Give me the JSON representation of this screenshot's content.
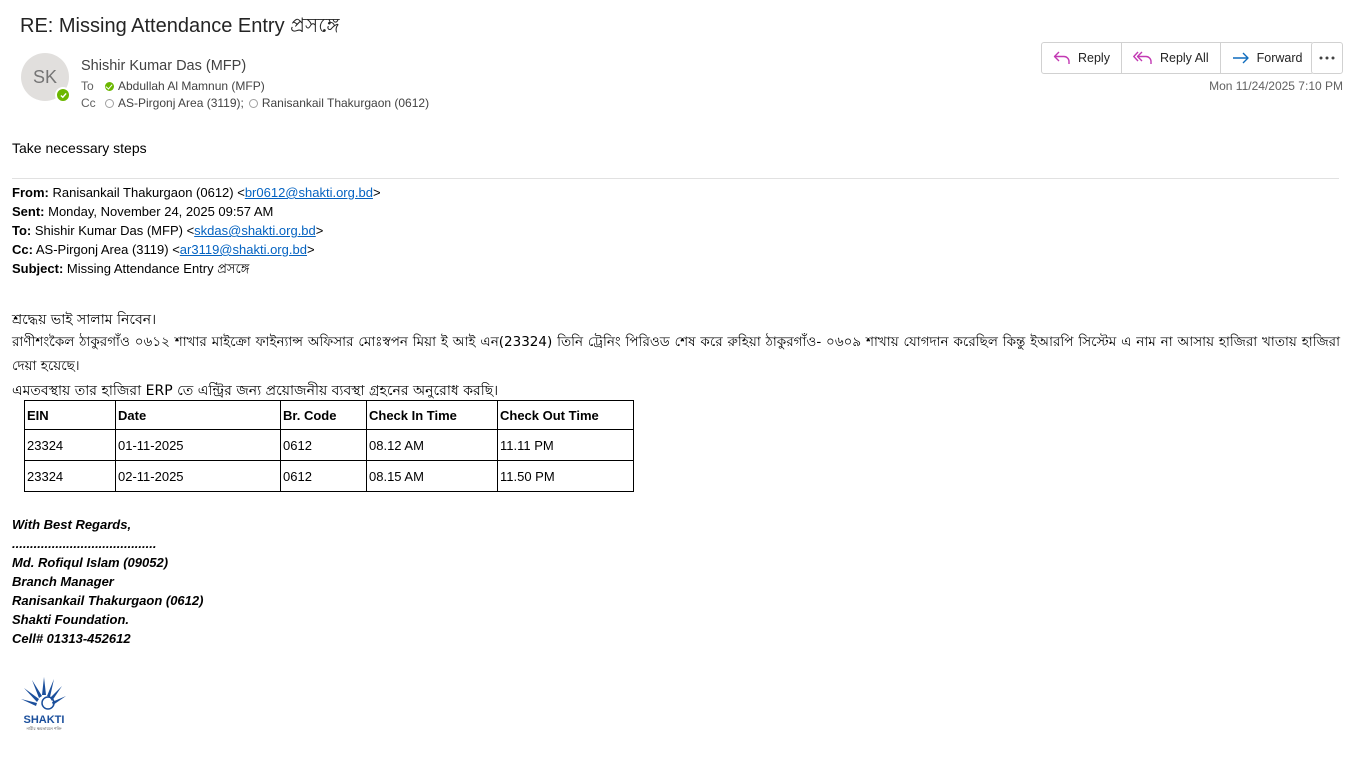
{
  "subject": "RE: Missing Attendance Entry প্রসঙ্গে",
  "sender": {
    "initials": "SK",
    "name": "Shishir Kumar Das (MFP)"
  },
  "to": {
    "label": "To",
    "recipients": [
      "Abdullah Al Mamnun (MFP)"
    ]
  },
  "cc": {
    "label": "Cc",
    "recipients": [
      "AS-Pirgonj Area (3119);",
      "Ranisankail Thakurgaon (0612)"
    ]
  },
  "actions": {
    "reply": "Reply",
    "reply_all": "Reply All",
    "forward": "Forward"
  },
  "timestamp": "Mon 11/24/2025 7:10 PM",
  "reply_body": "Take necessary steps",
  "original": {
    "from_label": "From:",
    "from_text": "Ranisankail Thakurgaon (0612) <",
    "from_email": "br0612@shakti.org.bd",
    "from_close": ">",
    "sent_label": "Sent:",
    "sent_text": "Monday, November 24, 2025 09:57 AM",
    "to_label": "To:",
    "to_text": "Shishir Kumar Das (MFP) <",
    "to_email": "skdas@shakti.org.bd",
    "to_close": ">",
    "cc_label": "Cc:",
    "cc_text": "AS-Pirgonj Area (3119) <",
    "cc_email": "ar3119@shakti.org.bd",
    "cc_close": ">",
    "subject_label": "Subject:",
    "subject_text": "Missing Attendance Entry প্রসঙ্গে"
  },
  "bengali": {
    "greeting": "শ্রদ্ধেয় ভাই সালাম নিবেন।",
    "paragraph": "রাণীশংকৈল ঠাকুরগাঁও ০৬১২ শাখার  মাইক্রো ফাইন্যান্স অফিসার মোঃস্বপন মিয়া ই আই এন(23324) তিনি ট্রেনিং পিরিওড শেষ করে রুহিয়া ঠাকুরগাঁও- ০৬০৯ শাখায় যোগদান করেছিল কিন্তু ইআরপি সিস্টেম এ নাম না আসায় হাজিরা খাতায় হাজিরা দেয়া হয়েছে।",
    "request": "এমতবস্থায় তার হাজিরা ERP তে এন্ট্রির জন্য প্রয়োজনীয় ব্যবস্থা গ্রহনের অনুরোধ করছি।"
  },
  "table": {
    "headers": [
      "EIN",
      "Date",
      "Br. Code",
      "Check In Time",
      "Check Out Time"
    ],
    "rows": [
      [
        "23324",
        "01-11-2025",
        "0612",
        "08.12 AM",
        "11.11 PM"
      ],
      [
        "23324",
        "02-11-2025",
        "0612",
        "08.15 AM",
        "11.50 PM"
      ]
    ]
  },
  "signature": {
    "regards": "With Best Regards,",
    "dots": "........................................",
    "name": "Md. Rofiqul Islam (09052)",
    "title": "Branch Manager",
    "branch": "Ranisankail Thakurgaon (0612)",
    "org": "Shakti Foundation.",
    "cell": "Cell# 01313-452612"
  },
  "logo": {
    "text": "SHAKTI",
    "tagline": "নারীর ক্ষমতায়নে শক্তি"
  },
  "colors": {
    "link": "#0563c1",
    "presence": "#6bb700",
    "reply_icon": "#c239b3",
    "forward_icon": "#0f6cbd"
  },
  "icons": [
    "reply-icon",
    "reply-all-icon",
    "forward-icon",
    "more-icon",
    "presence-available-icon"
  ]
}
